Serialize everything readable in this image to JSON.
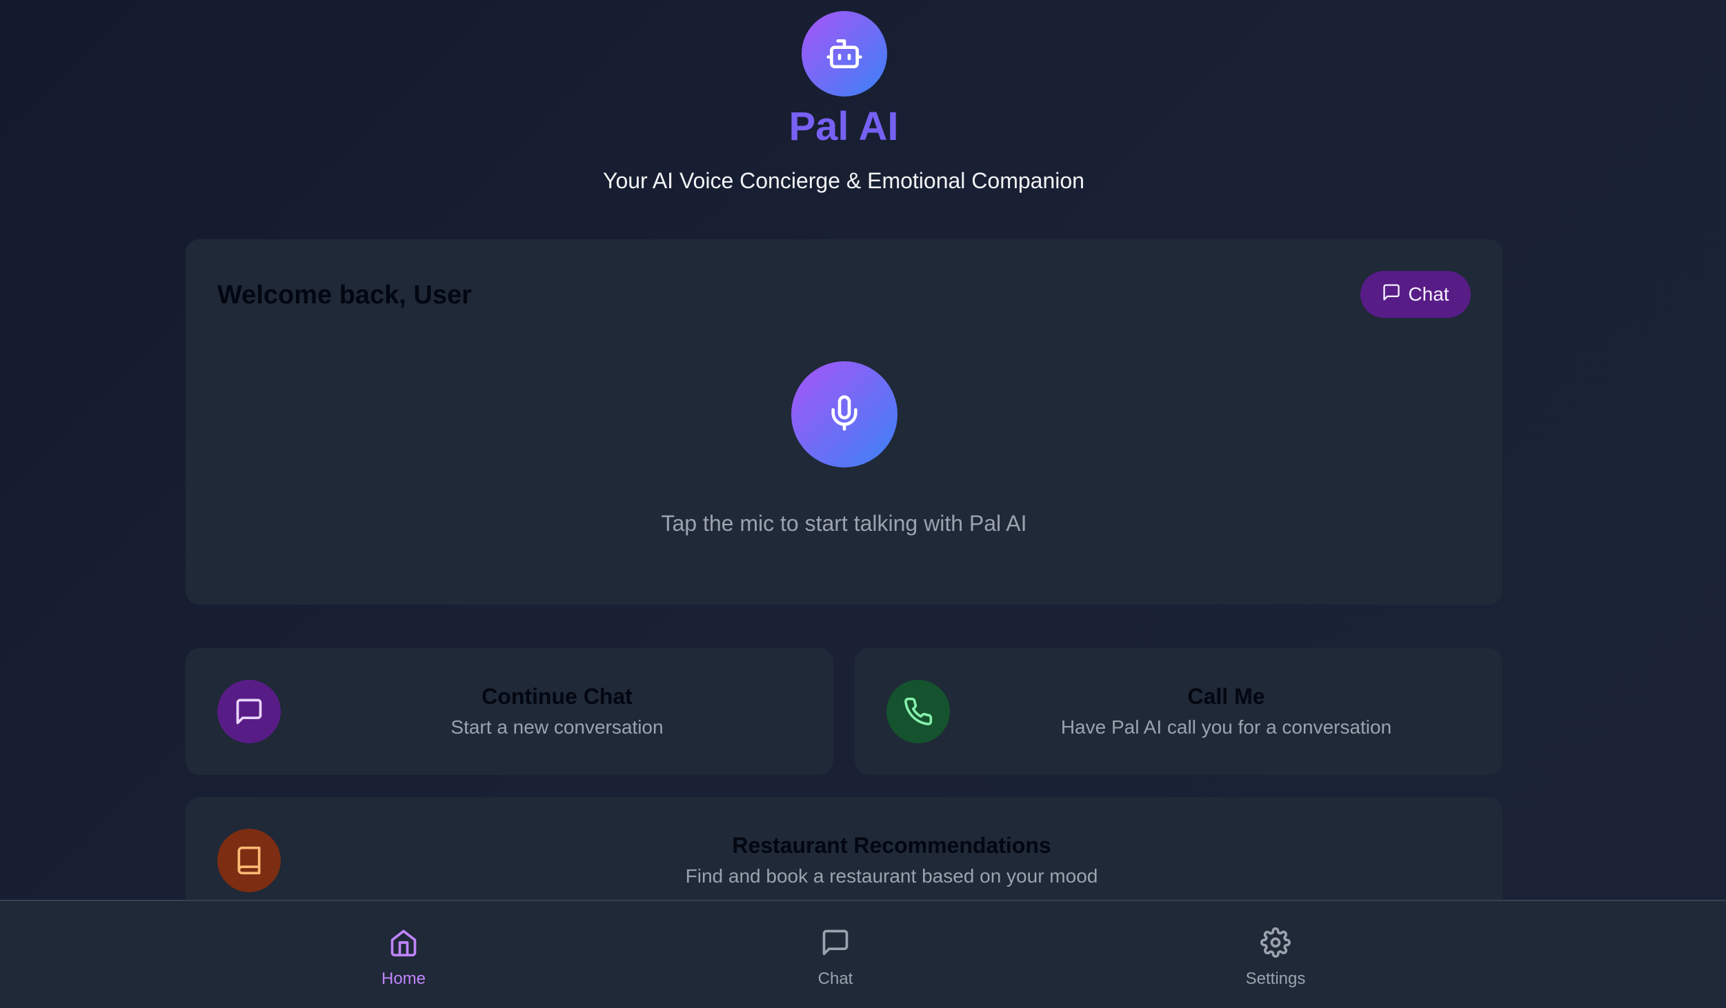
{
  "header": {
    "logo_icon": "bot-icon",
    "title": "Pal AI",
    "tagline": "Your AI Voice Concierge & Emotional Companion"
  },
  "main_card": {
    "welcome": "Welcome back, User",
    "chat_button": {
      "label": "Chat",
      "icon": "message-square-icon"
    },
    "mic_icon": "mic-icon",
    "hint": "Tap the mic to start talking with Pal AI"
  },
  "actions": [
    {
      "title": "Continue Chat",
      "subtitle": "Start a new conversation",
      "icon": "message-square-icon",
      "color": "#581c87"
    },
    {
      "title": "Call Me",
      "subtitle": "Have Pal AI call you for a conversation",
      "icon": "phone-icon",
      "color": "#14532d"
    },
    {
      "title": "Restaurant Recommendations",
      "subtitle": "Find and book a restaurant based on your mood",
      "icon": "book-icon",
      "color": "#7c2d12"
    }
  ],
  "nav": {
    "items": [
      {
        "label": "Home",
        "icon": "home-icon",
        "active": true
      },
      {
        "label": "Chat",
        "icon": "message-square-icon",
        "active": false
      },
      {
        "label": "Settings",
        "icon": "gear-icon",
        "active": false
      }
    ]
  },
  "colors": {
    "accent": "#8b5cf6",
    "active_nav": "#c084fc",
    "card": "#1f2937"
  }
}
